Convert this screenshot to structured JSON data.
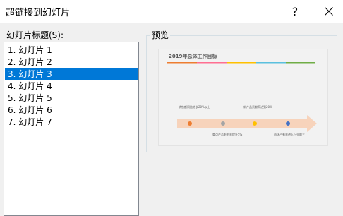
{
  "dialog": {
    "title": "超链接到幻灯片",
    "help_label": "?"
  },
  "list": {
    "label": "幻灯片标题(S):",
    "items": [
      "1. 幻灯片 1",
      "2. 幻灯片 2",
      "3. 幻灯片 3",
      "4. 幻灯片 4",
      "5. 幻灯片 5",
      "6. 幻灯片 6",
      "7. 幻灯片 7"
    ],
    "selected_index": 2
  },
  "preview": {
    "label": "预览",
    "slide_title": "2019年总体工作目标",
    "milestones": [
      {
        "text": "销售额同比增长20%以上",
        "color": "#ed7d31"
      },
      {
        "text": "重点产品毛利率提升5%",
        "color": "#a5a5a5"
      },
      {
        "text": "新产品贡献率达到20%",
        "color": "#ffc000"
      },
      {
        "text": "市场占有率进入行业前三",
        "color": "#4472c4"
      }
    ],
    "accent_colors": [
      "#ed7d31",
      "#a5a5a5",
      "#ffc000",
      "#4472c4",
      "#5bc0de"
    ]
  }
}
